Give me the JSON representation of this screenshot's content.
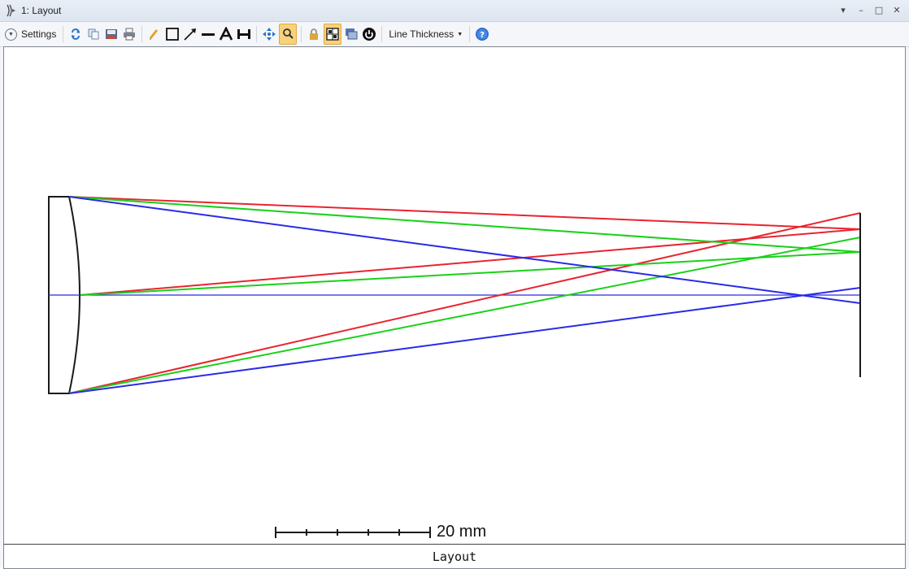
{
  "window": {
    "title": "1: Layout"
  },
  "toolbar": {
    "settings_label": "Settings",
    "line_thickness_label": "Line Thickness",
    "icons": [
      "refresh-icon",
      "copy-icon",
      "save-icon",
      "print-icon",
      "pencil-icon",
      "rectangle-icon",
      "arrow-icon",
      "line-icon",
      "text-icon",
      "dimension-icon",
      "pan-icon",
      "zoom-icon",
      "lock-icon",
      "grid-icon",
      "window-icon",
      "power-icon",
      "help-icon"
    ]
  },
  "plot": {
    "scale_bar_label": "20 mm",
    "footer_label": "Layout",
    "ray_colors": {
      "field1": "#2a2ae6",
      "field2": "#19d119",
      "field3": "#e8242f"
    }
  }
}
